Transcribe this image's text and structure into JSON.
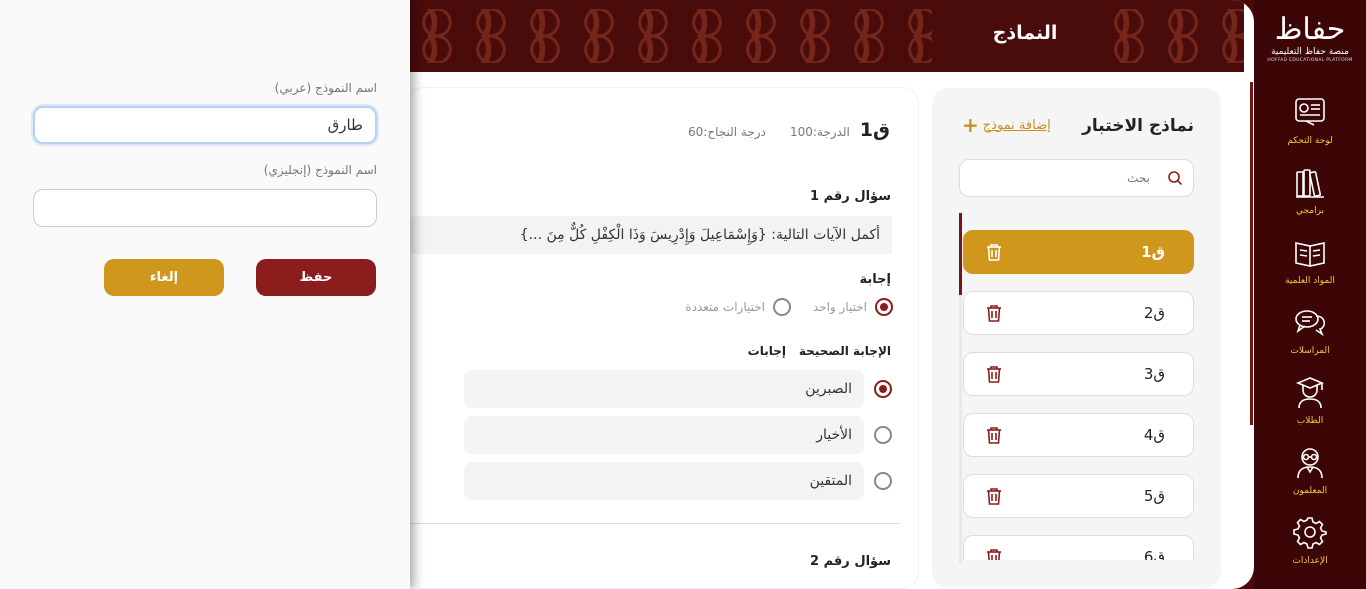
{
  "brand": {
    "name_ar": "منصة حفاظ التعليمية",
    "name_en": "HOFFAD EDUCATIONAL PLATFORM",
    "logo_glyph": "حفاظ"
  },
  "nav": [
    {
      "label": "لوحة التحكم",
      "icon": "dashboard-icon"
    },
    {
      "label": "برامجي",
      "icon": "books-icon"
    },
    {
      "label": "المواد العلمية",
      "icon": "book-open-icon"
    },
    {
      "label": "المراسلات",
      "icon": "chat-bubbles-icon"
    },
    {
      "label": "الطلاب",
      "icon": "graduate-icon"
    },
    {
      "label": "المعلمون",
      "icon": "teacher-icon"
    },
    {
      "label": "الإعدادات",
      "icon": "gear-icon"
    }
  ],
  "header": {
    "title": "النماذج"
  },
  "models_panel": {
    "title": "نماذج الاختبار",
    "add_label": "إضافة نموذج",
    "add_icon": "plus-icon",
    "search_placeholder": "بحث",
    "items": [
      {
        "name": "ق1",
        "active": true
      },
      {
        "name": "ق2",
        "active": false
      },
      {
        "name": "ق3",
        "active": false
      },
      {
        "name": "ق4",
        "active": false
      },
      {
        "name": "ق5",
        "active": false
      },
      {
        "name": "ق6",
        "active": false
      }
    ]
  },
  "question_panel": {
    "title": "ق1",
    "grade": "الدرجة:100",
    "pass_grade": "درجة النجاح:60",
    "question_1": {
      "number_label": "سؤال رقم 1",
      "text": "أكمل الآيات التالية: {وَإِسْمَاعِيلَ وَإِدْرِيسَ وَذَا الْكِفْلِ كُلٌّ مِنَ ...}",
      "answer_label": "إجابة",
      "type_single": "اختيار واحد",
      "type_multi": "اختيارات متعددة",
      "correct_header": "الإجابة الصحيحة",
      "answers_header": "إجابات",
      "options": [
        {
          "text": "الصبرين",
          "correct": true
        },
        {
          "text": "الأخيار",
          "correct": false
        },
        {
          "text": "المتقين",
          "correct": false
        }
      ]
    },
    "question_2": {
      "number_label": "سؤال رقم 2"
    }
  },
  "form": {
    "name_ar_label": "اسم النموذج (عربي)",
    "name_ar_value": "طارق",
    "name_en_label": "اسم النموذج (إنجليزي)",
    "name_en_value": "",
    "save_label": "حفظ",
    "cancel_label": "إلغاء"
  },
  "colors": {
    "brand_dark": "#3d0606",
    "header": "#4a0b0b",
    "accent_gold": "#cf981d",
    "accent_red": "#8b1d1d"
  }
}
